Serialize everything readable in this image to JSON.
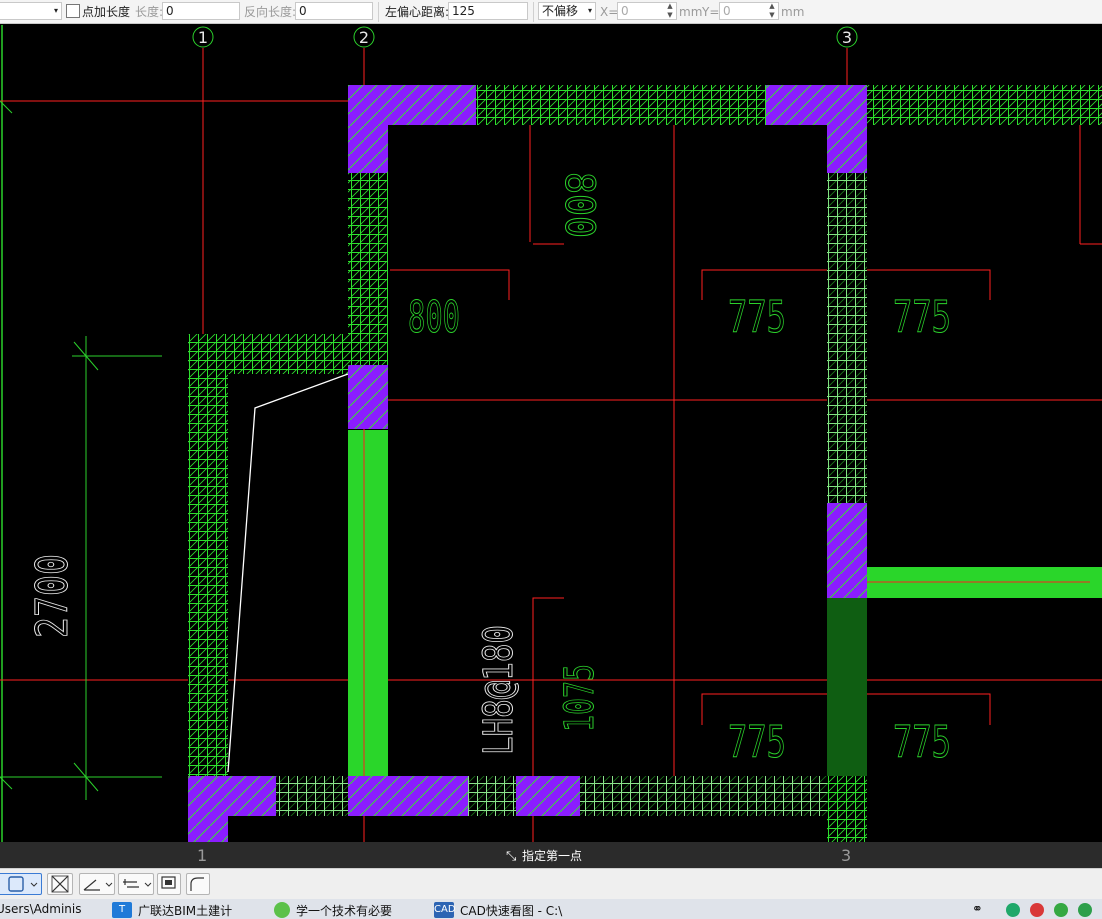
{
  "toolbar": {
    "add_length_label": "点加长度",
    "length_label": "长度:",
    "length_value": "0",
    "reverse_length_label": "反向长度:",
    "reverse_length_value": "0",
    "left_offset_label": "左偏心距离:",
    "left_offset_value": "125",
    "offset_mode": "不偏移",
    "x_label": "X=",
    "x_value": "0",
    "x_unit": "mm",
    "y_label": "Y=",
    "y_value": "0",
    "y_unit": "mm"
  },
  "drawing": {
    "axis_labels": [
      "1",
      "2",
      "3"
    ],
    "dims": {
      "d_800_vertical": "800",
      "d_800": "800",
      "d_775_a": "775",
      "d_775_b": "775",
      "d_2700": "2700",
      "d_1075": "1075",
      "d_775_c": "775",
      "d_775_d": "775",
      "beam_label": "LH8@180"
    },
    "colors": {
      "wall_hatch": "#22dd22",
      "column": "#8a20ff",
      "beam": "#2ad62a",
      "axis": "#ff2020",
      "dim_line": "#2bd12b"
    }
  },
  "status": {
    "prompt": "指定第一点",
    "axis_bottom_1": "1",
    "axis_bottom_3": "3"
  },
  "taskbar": {
    "path": "Users\\Adminis",
    "app1": "广联达BIM土建计",
    "app2": "学一个技术有必要",
    "app3": "CAD快速看图 - C:\\"
  }
}
